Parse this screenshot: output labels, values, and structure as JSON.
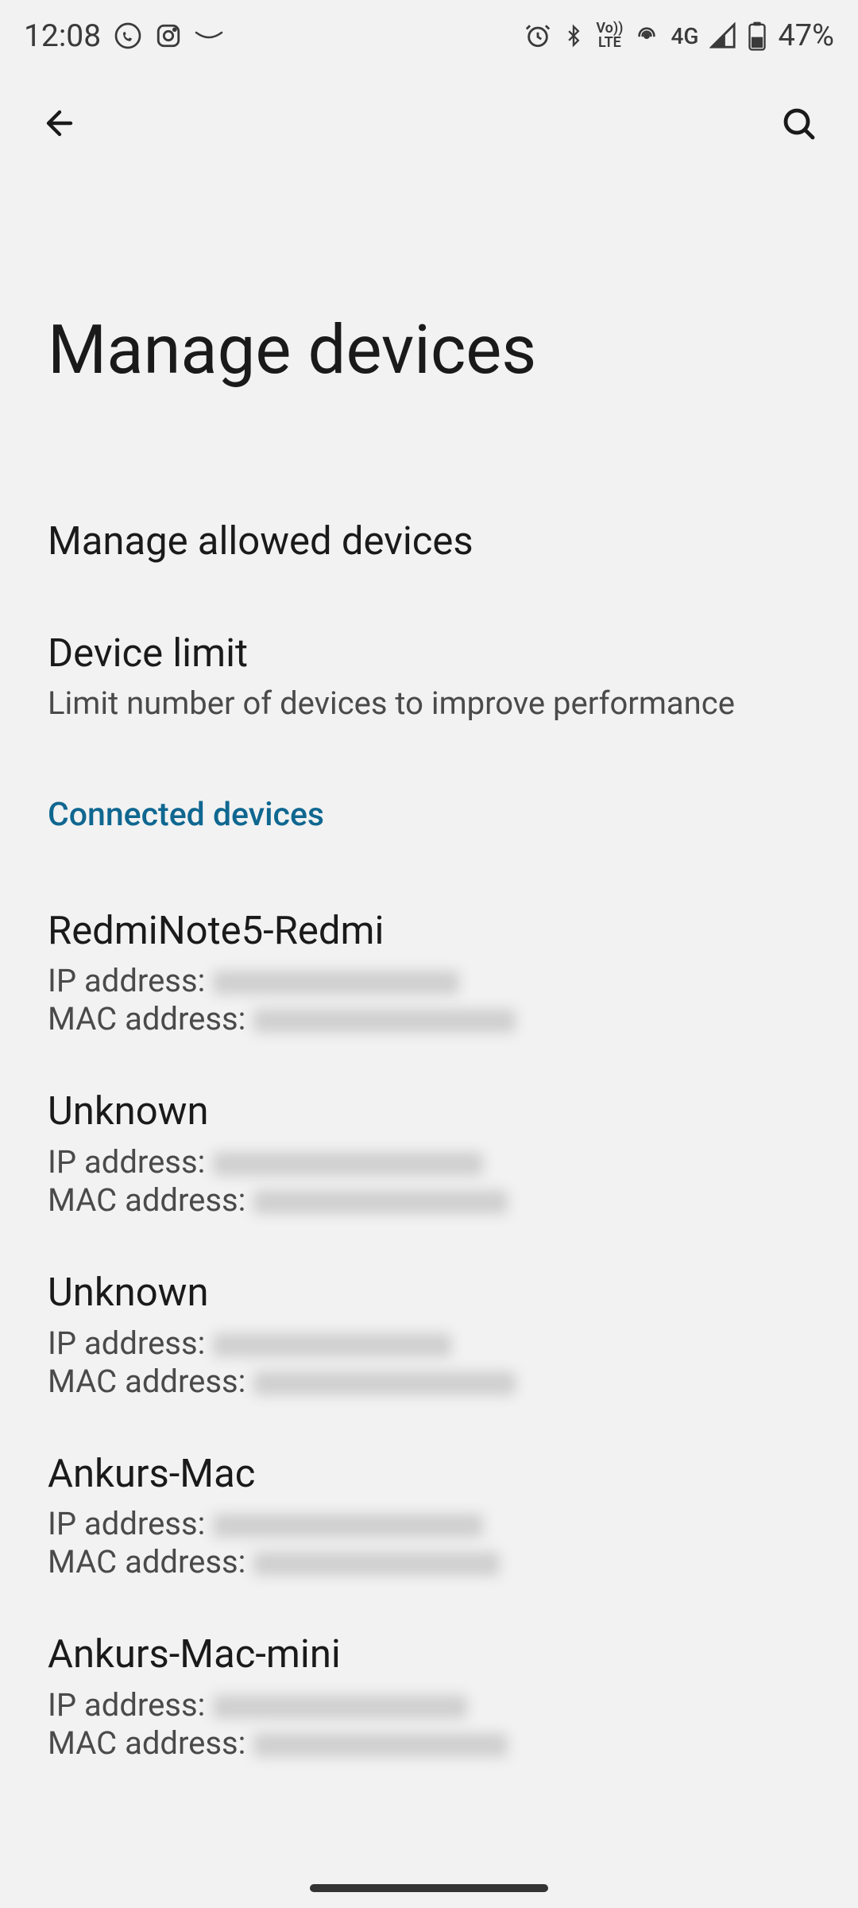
{
  "status_bar": {
    "time": "12:08",
    "network_type": "4G",
    "battery_percent": "47%"
  },
  "page": {
    "title": "Manage devices"
  },
  "menu": {
    "manage_allowed": {
      "title": "Manage allowed devices"
    },
    "device_limit": {
      "title": "Device limit",
      "subtitle": "Limit number of devices to improve performance"
    }
  },
  "section_header": "Connected devices",
  "ip_label": "IP address:",
  "mac_label": "MAC address:",
  "devices": [
    {
      "name": "RedmiNote5-Redmi",
      "ip_width": 310,
      "mac_width": 330
    },
    {
      "name": "Unknown",
      "ip_width": 340,
      "mac_width": 320
    },
    {
      "name": "Unknown",
      "ip_width": 300,
      "mac_width": 330
    },
    {
      "name": "Ankurs-Mac",
      "ip_width": 340,
      "mac_width": 310
    },
    {
      "name": "Ankurs-Mac-mini",
      "ip_width": 320,
      "mac_width": 320
    }
  ]
}
